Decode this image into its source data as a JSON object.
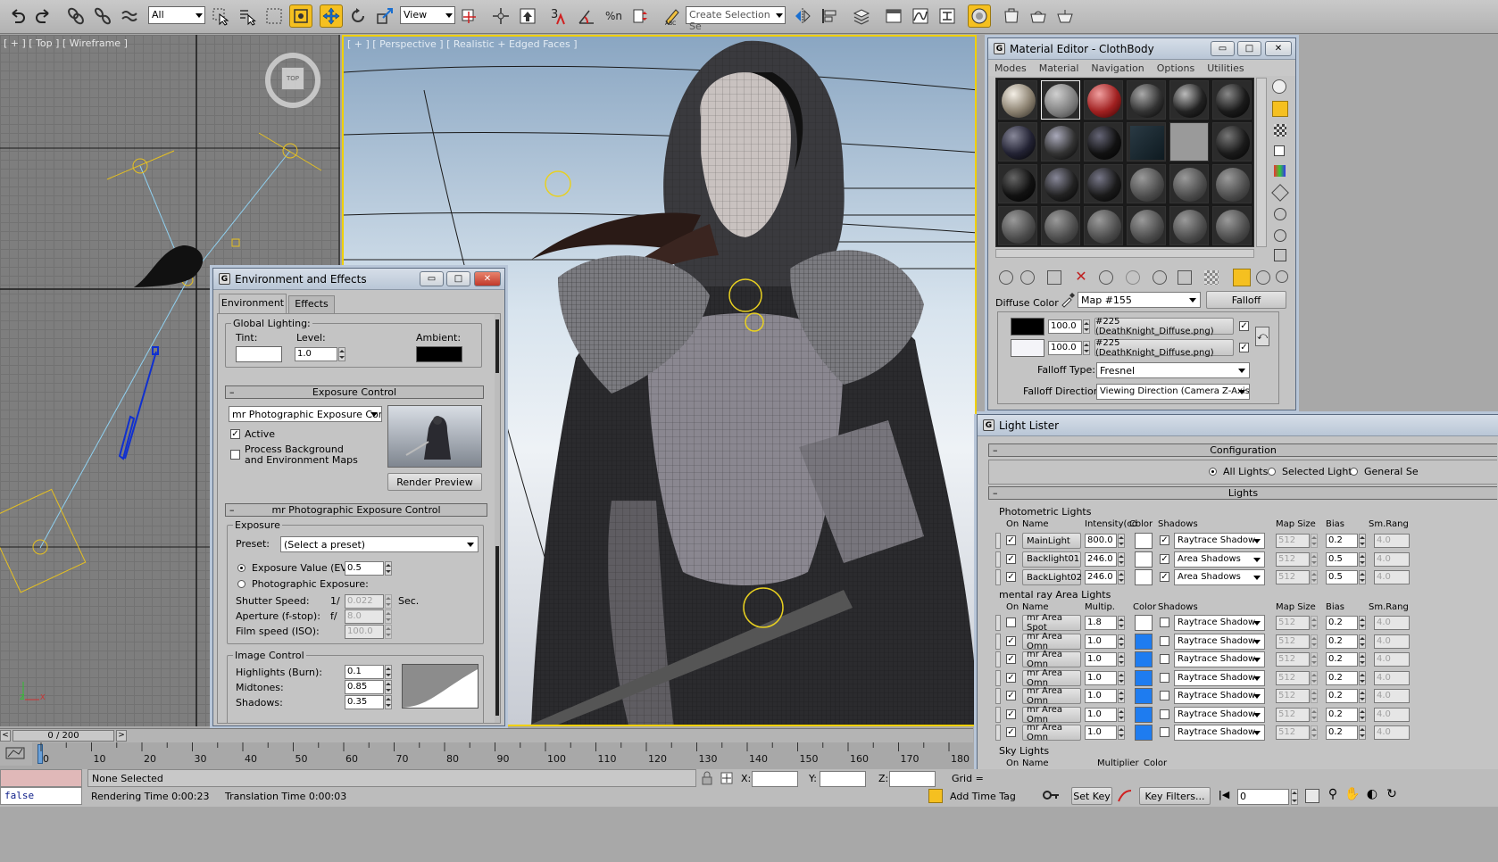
{
  "toolbar": {
    "selection_filter": "All",
    "coord_system": "View",
    "named_selection": "Create Selection Se",
    "snap_label": "3",
    "percent_snap": "%n"
  },
  "viewports": {
    "top_label": "[ + ] [ Top ] [ Wireframe ]",
    "persp_label": "[ + ] [ Perspective ] [ Realistic + Edged Faces ]",
    "viewcube_label": "TOP"
  },
  "env": {
    "title": "Environment and Effects",
    "tabs": [
      "Environment",
      "Effects"
    ],
    "global_lighting": "Global Lighting:",
    "tint": "Tint:",
    "level": "Level:",
    "level_value": "1.0",
    "ambient": "Ambient:",
    "exposure_control": "Exposure Control",
    "exposure_type": "mr Photographic Exposure Contro",
    "active": "Active",
    "process_bg_1": "Process Background",
    "process_bg_2": "and Environment Maps",
    "render_preview": "Render Preview",
    "mr_rollout": "mr Photographic Exposure Control",
    "exposure_group": "Exposure",
    "preset": "Preset:",
    "preset_value": "(Select a preset)",
    "ev_label": "Exposure Value (EV):",
    "ev_value": "0.5",
    "photo_exposure": "Photographic Exposure:",
    "shutter": "Shutter Speed:",
    "shutter_prefix": "1/",
    "shutter_value": "0.022",
    "shutter_unit": "Sec.",
    "aperture": "Aperture (f-stop):",
    "aperture_prefix": "f/",
    "aperture_value": "8.0",
    "film": "Film speed (ISO):",
    "film_value": "100.0",
    "image_control": "Image Control",
    "highlights": "Highlights (Burn):",
    "highlights_value": "0.1",
    "midtones": "Midtones:",
    "midtones_value": "0.85",
    "shadows": "Shadows:",
    "shadows_value": "0.35",
    "minimize": "▭",
    "maximize": "□",
    "close": "✕"
  },
  "mat": {
    "title": "Material Editor - ClothBody",
    "menu": [
      "Modes",
      "Material",
      "Navigation",
      "Options",
      "Utilities"
    ],
    "diffuse_color": "Diffuse Color",
    "map_name": "Map #155",
    "map_type": "Falloff",
    "row1_value": "100.0",
    "row1_map": "#225 (DeathKnight_Diffuse.png)",
    "row2_value": "100.0",
    "row2_map": "#225 (DeathKnight_Diffuse.png)",
    "falloff_type_label": "Falloff Type:",
    "falloff_type": "Fresnel",
    "falloff_dir_label": "Falloff Direction:",
    "falloff_dir": "Viewing Direction (Camera Z-Axis)",
    "check": "✓"
  },
  "lister": {
    "title": "Light Lister",
    "configuration": "Configuration",
    "all_lights": "All Lights",
    "selected_lights": "Selected Lights",
    "general_settings": "General Se",
    "lights": "Lights",
    "photometric": "Photometric Lights",
    "photo_headers": {
      "on": "On",
      "name": "Name",
      "intensity": "Intensity(cd",
      "color": "Color",
      "shadows": "Shadows",
      "mapsize": "Map Size",
      "bias": "Bias",
      "smrange": "Sm.Rang"
    },
    "photo_rows": [
      {
        "name": "MainLight",
        "value": "800.0",
        "shadow": "Raytrace Shadow",
        "mapsize": "512",
        "bias": "0.2",
        "sm": "4.0",
        "on": true,
        "cast": true,
        "color": "#ffffff"
      },
      {
        "name": "Backlight01",
        "value": "246.0",
        "shadow": "Area Shadows",
        "mapsize": "512",
        "bias": "0.5",
        "sm": "4.0",
        "on": true,
        "cast": true,
        "color": "#ffffff"
      },
      {
        "name": "BackLight02",
        "value": "246.0",
        "shadow": "Area Shadows",
        "mapsize": "512",
        "bias": "0.5",
        "sm": "4.0",
        "on": true,
        "cast": true,
        "color": "#ffffff"
      }
    ],
    "area": "mental ray Area Lights",
    "area_headers": {
      "on": "On",
      "name": "Name",
      "mult": "Multip.",
      "color": "Color",
      "shadows": "Shadows",
      "mapsize": "Map Size",
      "bias": "Bias",
      "smrange": "Sm.Rang"
    },
    "area_rows": [
      {
        "name": "mr Area Spot",
        "value": "1.8",
        "shadow": "Raytrace Shadow",
        "mapsize": "512",
        "bias": "0.2",
        "sm": "4.0",
        "on": false,
        "cast": false,
        "color": "#ffffff"
      },
      {
        "name": "mr Area Omn",
        "value": "1.0",
        "shadow": "Raytrace Shadow",
        "mapsize": "512",
        "bias": "0.2",
        "sm": "4.0",
        "on": true,
        "cast": false,
        "color": "#1e7cf0"
      },
      {
        "name": "mr Area Omn",
        "value": "1.0",
        "shadow": "Raytrace Shadow",
        "mapsize": "512",
        "bias": "0.2",
        "sm": "4.0",
        "on": true,
        "cast": false,
        "color": "#1e7cf0"
      },
      {
        "name": "mr Area Omn",
        "value": "1.0",
        "shadow": "Raytrace Shadow",
        "mapsize": "512",
        "bias": "0.2",
        "sm": "4.0",
        "on": true,
        "cast": false,
        "color": "#1e7cf0"
      },
      {
        "name": "mr Area Omn",
        "value": "1.0",
        "shadow": "Raytrace Shadow",
        "mapsize": "512",
        "bias": "0.2",
        "sm": "4.0",
        "on": true,
        "cast": false,
        "color": "#1e7cf0"
      },
      {
        "name": "mr Area Omn",
        "value": "1.0",
        "shadow": "Raytrace Shadow",
        "mapsize": "512",
        "bias": "0.2",
        "sm": "4.0",
        "on": true,
        "cast": false,
        "color": "#1e7cf0"
      },
      {
        "name": "mr Area Omn",
        "value": "1.0",
        "shadow": "Raytrace Shadow",
        "mapsize": "512",
        "bias": "0.2",
        "sm": "4.0",
        "on": true,
        "cast": false,
        "color": "#1e7cf0"
      }
    ],
    "sky": "Sky Lights",
    "sky_headers": {
      "on": "On",
      "name": "Name",
      "mult": "Multiplier",
      "color": "Color"
    },
    "check": "✓"
  },
  "timeline": {
    "frame": "0 / 200",
    "ticks": [
      "0",
      "10",
      "20",
      "30",
      "40",
      "50",
      "60",
      "70",
      "80",
      "90",
      "100",
      "110",
      "120",
      "130",
      "140",
      "150",
      "160",
      "170",
      "180"
    ]
  },
  "status": {
    "script_value": "false",
    "selection": "None Selected",
    "render_time": "Rendering Time  0:00:23",
    "translation_time": "Translation Time  0:00:03",
    "x_label": "X:",
    "y_label": "Y:",
    "z_label": "Z:",
    "grid_label": "Grid =",
    "add_time_tag": "Add Time Tag",
    "set_key": "Set Key",
    "key_filters": "Key Filters...",
    "frame_value": "0"
  },
  "colors": {
    "active_tool": "#f5c020",
    "viewport_border": "#f0d000",
    "light_blue": "#1e7cf0"
  }
}
